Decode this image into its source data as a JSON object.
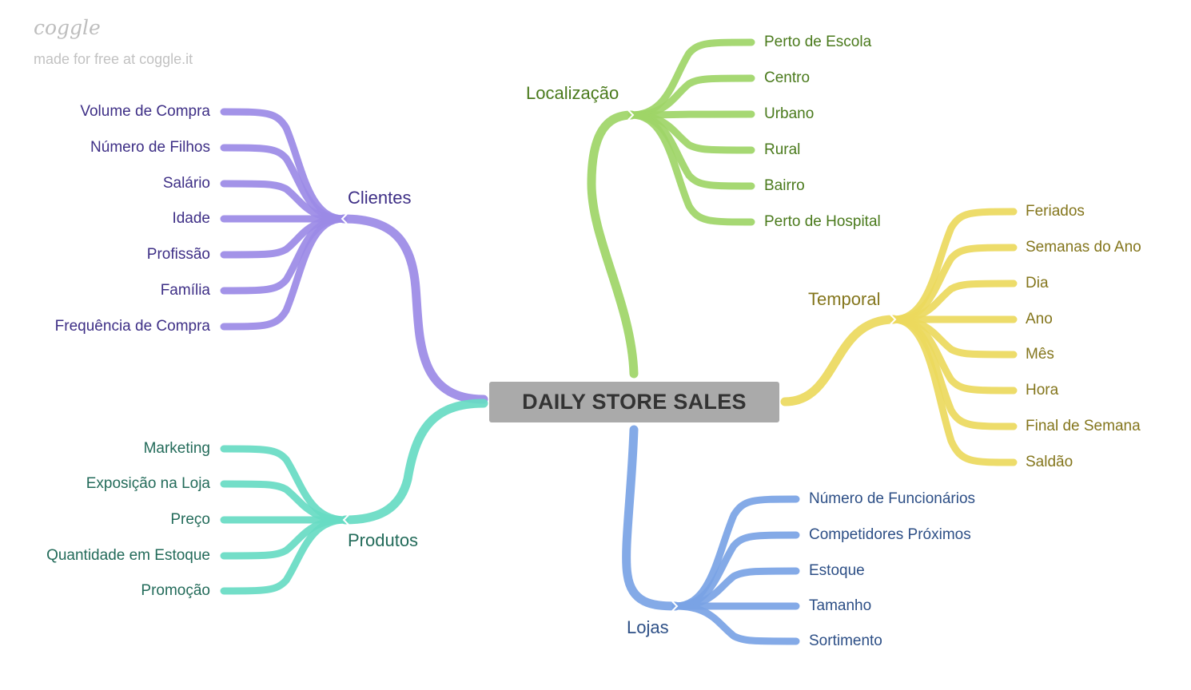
{
  "watermark": {
    "logo": "coggle",
    "tagline": "made for free at coggle.it"
  },
  "root": {
    "label": "DAILY STORE SALES"
  },
  "branches": {
    "localizacao": {
      "label": "Localização",
      "color": "#9ed567",
      "text_color": "#4a7a1c",
      "children": [
        "Perto de Escola",
        "Centro",
        "Urbano",
        "Rural",
        "Bairro",
        "Perto de Hospital"
      ]
    },
    "temporal": {
      "label": "Temporal",
      "color": "#ebd95d",
      "text_color": "#84761d",
      "children": [
        "Feriados",
        "Semanas do Ano",
        "Dia",
        "Ano",
        "Mês",
        "Hora",
        "Final de Semana",
        "Saldão"
      ]
    },
    "lojas": {
      "label": "Lojas",
      "color": "#7aa3e5",
      "text_color": "#2d4f86",
      "children": [
        "Número de Funcionários",
        "Competidores Próximos",
        "Estoque",
        "Tamanho",
        "Sortimento"
      ]
    },
    "clientes": {
      "label": "Clientes",
      "color": "#9b8ae6",
      "text_color": "#3e2f86",
      "children": [
        "Volume de Compra",
        "Número de Filhos",
        "Salário",
        "Idade",
        "Profissão",
        "Família",
        "Frequência de Compra"
      ]
    },
    "produtos": {
      "label": "Produtos",
      "color": "#67dbc3",
      "text_color": "#236b5a",
      "children": [
        "Marketing",
        "Exposição na Loja",
        "Preço",
        "Quantidade em Estoque",
        "Promoção"
      ]
    }
  }
}
